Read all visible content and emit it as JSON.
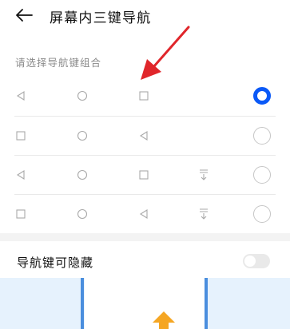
{
  "header": {
    "title": "屏幕内三键导航"
  },
  "section": {
    "label": "请选择导航键组合"
  },
  "options": [
    {
      "keys": [
        "back-icon",
        "home-icon",
        "recent-icon"
      ],
      "selected": true
    },
    {
      "keys": [
        "recent-icon",
        "home-icon",
        "back-icon"
      ],
      "selected": false
    },
    {
      "keys": [
        "back-icon",
        "home-icon",
        "recent-icon",
        "notification-pulldown-icon"
      ],
      "selected": false
    },
    {
      "keys": [
        "recent-icon",
        "home-icon",
        "back-icon",
        "notification-pulldown-icon"
      ],
      "selected": false
    }
  ],
  "hide_toggle": {
    "label": "导航键可隐藏",
    "enabled": false
  },
  "colors": {
    "accent": "#0a59f7",
    "annotation_arrow": "#e0262b",
    "preview_arrow": "#f5a623",
    "preview_bg": "#e6f2fd",
    "preview_frame": "#4a8ede"
  }
}
